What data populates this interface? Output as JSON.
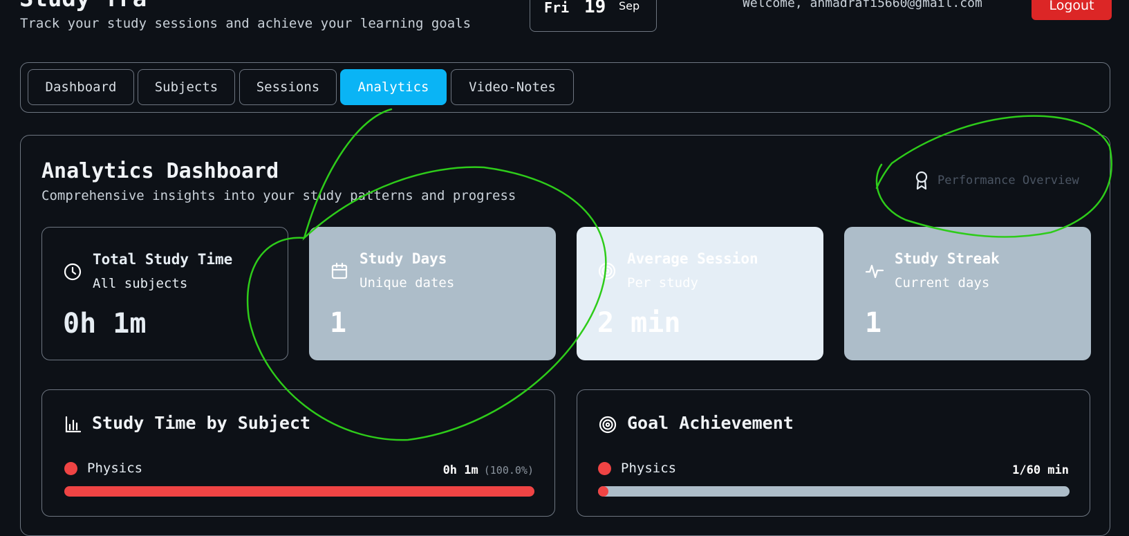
{
  "header": {
    "app_title": "Study Tra",
    "subtitle": "Track your study sessions and achieve your learning goals",
    "date": {
      "day": "Fri",
      "number": "19",
      "month": "Sep"
    },
    "welcome": "Welcome, ahmadrafi5660@gmail.com",
    "logout_label": "Logout"
  },
  "tabs": [
    {
      "label": "Dashboard",
      "active": false
    },
    {
      "label": "Subjects",
      "active": false
    },
    {
      "label": "Sessions",
      "active": false
    },
    {
      "label": "Analytics",
      "active": true
    },
    {
      "label": "Video-Notes",
      "active": false
    }
  ],
  "analytics": {
    "title": "Analytics Dashboard",
    "subtitle": "Comprehensive insights into your study patterns and progress",
    "performance_label": "Performance Overview",
    "performance_icon": "award-icon",
    "cards": [
      {
        "title": "Total Study Time",
        "sub": "All subjects",
        "value": "0h 1m",
        "icon": "clock-icon"
      },
      {
        "title": "Study Days",
        "sub": "Unique dates",
        "value": "1",
        "icon": "calendar-icon"
      },
      {
        "title": "Average Session",
        "sub": "Per study",
        "value": "2 min",
        "icon": "target-icon"
      },
      {
        "title": "Study Streak",
        "sub": "Current days",
        "value": "1",
        "icon": "activity-icon"
      }
    ],
    "time_by_subject": {
      "title": "Study Time by Subject",
      "icon": "bar-chart-icon",
      "items": [
        {
          "subject": "Physics",
          "time": "0h 1m",
          "percent_label": "(100.0%)",
          "fraction": 1.0,
          "color": "#ef4444"
        }
      ]
    },
    "goal_achievement": {
      "title": "Goal Achievement",
      "icon": "target-icon",
      "items": [
        {
          "subject": "Physics",
          "progress_label": "1/60 min",
          "fraction": 0.0167,
          "color": "#ef4444"
        }
      ]
    }
  },
  "colors": {
    "background": "#0d1117",
    "accent_tab": "#0ab4f5",
    "logout": "#dc2626",
    "subject_red": "#ef4444",
    "card_slate": "#adbdc9",
    "card_pale": "#e5eef6",
    "annotation_green": "#2ecc1a"
  }
}
